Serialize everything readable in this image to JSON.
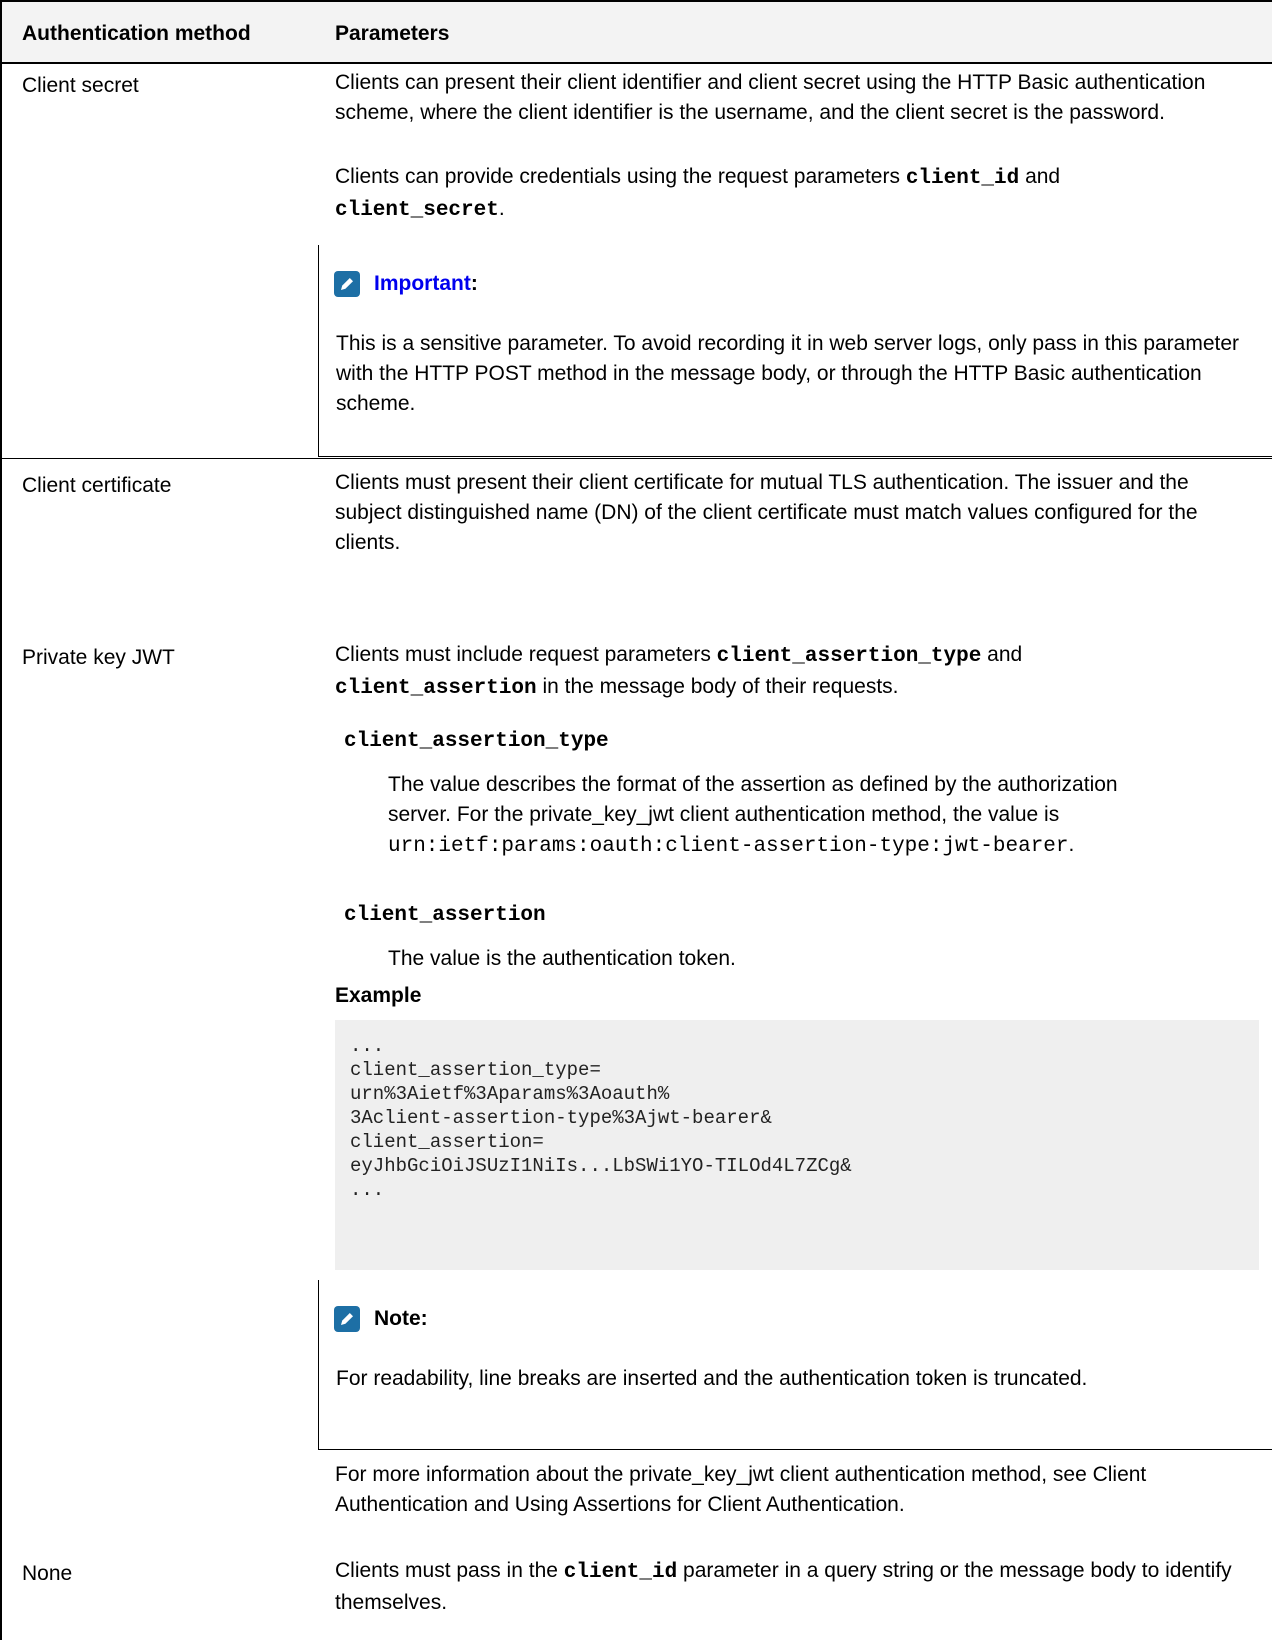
{
  "table": {
    "headers": [
      "Authentication method",
      "Parameters"
    ],
    "rows": [
      {
        "method": "Client secret",
        "p1": "Clients can present their client identifier and client secret using the HTTP Basic authentication scheme, where the client identifier is the username, and the client secret is the password.",
        "p2_pre": "Clients can provide credentials using the request parameters ",
        "p2_code1": "client_id",
        "p2_mid": " and ",
        "p2_code2": "client_secret",
        "p2_post": ".",
        "note_title": "Important",
        "note_colon": ":",
        "note_body": "This is a sensitive parameter. To avoid recording it in web server logs, only pass in this parameter with the HTTP POST method in the message body, or through the HTTP Basic authentication scheme."
      },
      {
        "method": "Client certificate",
        "p1": "Clients must present their client certificate for mutual TLS authentication. The issuer and the subject distinguished name (DN) of the client certificate must match values configured for the clients."
      },
      {
        "method": "Private key JWT",
        "p1_pre": "Clients must include request parameters ",
        "p1_code1": "client_assertion_type",
        "p1_mid": " and",
        "p1_code2": "client_assertion",
        "p1_post": " in the message body of their requests.",
        "dt1": "client_assertion_type",
        "dd1_pre": "The value describes the format of the assertion as defined by the authorization server. For the private_key_jwt client authentication method, the value is ",
        "dd1_code": "urn:ietf:params:oauth:client-assertion-type:jwt-bearer",
        "dd1_post": ".",
        "dt2": "client_assertion",
        "dd2": "The value is the authentication token.",
        "example_heading": "Example",
        "example_code": "...\nclient_assertion_type=\nurn%3Aietf%3Aparams%3Aoauth%\n3Aclient-assertion-type%3Ajwt-bearer&\nclient_assertion=\neyJhbGciOiJSUzI1NiIs...LbSWi1YO-TILOd4L7ZCg&\n...",
        "note_title": "Note:",
        "note_body": "For readability, line breaks are inserted and the authentication token is truncated.",
        "more": "For more information about the private_key_jwt client authentication method, see Client Authentication and Using Assertions for Client Authentication."
      },
      {
        "method": "None",
        "p1_pre": "Clients must pass in the ",
        "p1_code": "client_id",
        "p1_post": " parameter in a query string or the message body to identify themselves."
      }
    ]
  },
  "colors": {
    "important_link": "#0000ee",
    "note_icon": "#1d6fa5",
    "header_bg": "#f3f3f3",
    "code_bg": "#efefef"
  },
  "icons": {
    "note": "pencil-icon"
  }
}
